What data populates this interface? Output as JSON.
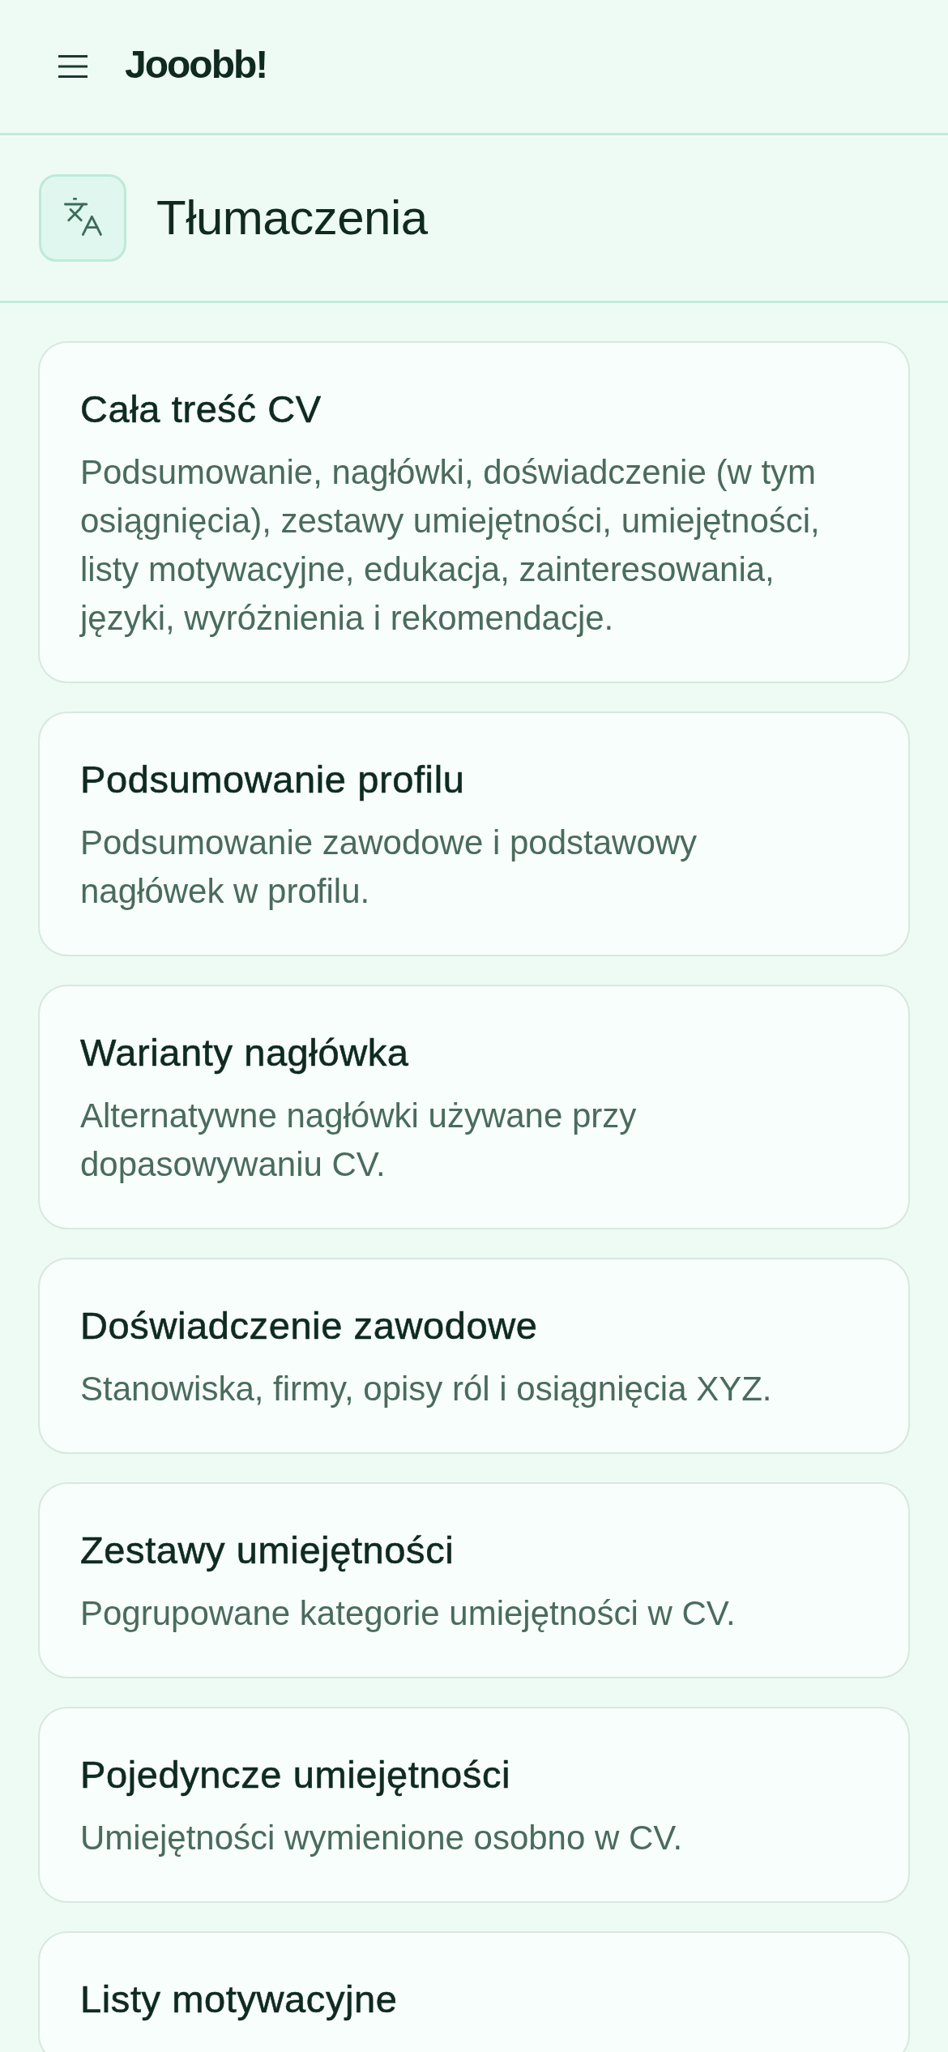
{
  "header": {
    "app_title": "Jooobb!"
  },
  "section": {
    "title": "Tłumaczenia"
  },
  "cards": [
    {
      "title": "Cała treść CV",
      "description": "Podsumowanie, nagłówki, doświadczenie (w tym osiągnięcia), zestawy umiejętności, umiejętności, listy motywacyjne, edukacja, zainteresowania, języki, wyróżnienia i rekomendacje."
    },
    {
      "title": "Podsumowanie profilu",
      "description": "Podsumowanie zawodowe i podstawowy nagłówek w profilu."
    },
    {
      "title": "Warianty nagłówka",
      "description": "Alternatywne nagłówki używane przy dopasowywaniu CV."
    },
    {
      "title": "Doświadczenie zawodowe",
      "description": "Stanowiska, firmy, opisy ról i osiągnięcia XYZ."
    },
    {
      "title": "Zestawy umiejętności",
      "description": "Pogrupowane kategorie umiejętności w CV."
    },
    {
      "title": "Pojedyncze umiejętności",
      "description": "Umiejętności wymienione osobno w CV."
    },
    {
      "title": "Listy motywacyjne"
    }
  ]
}
